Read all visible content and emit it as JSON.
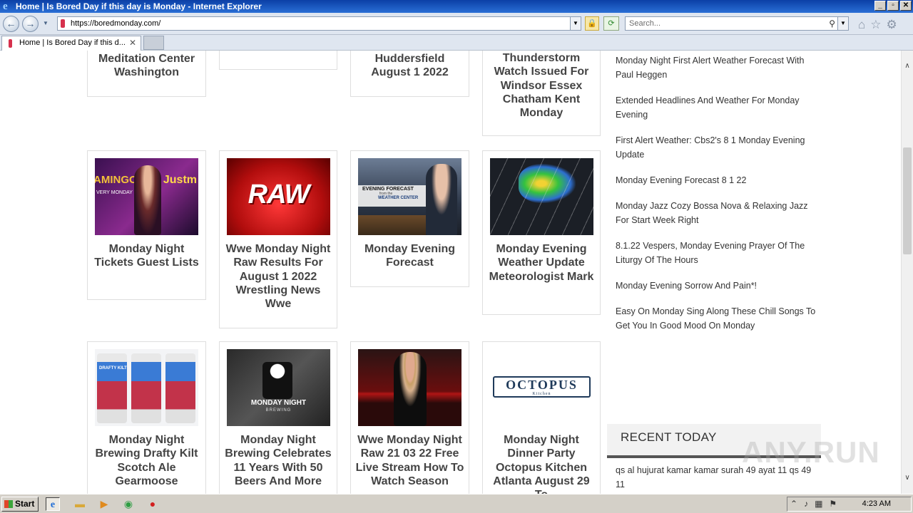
{
  "window": {
    "title": "Home | Is Bored Day if this day is Monday - Internet Explorer",
    "controls": [
      "_",
      "▫",
      "✕"
    ]
  },
  "nav": {
    "back_icon": "back-arrow-icon",
    "forward_icon": "forward-arrow-icon",
    "url": "https://boredmonday.com/",
    "search_placeholder": "Search..."
  },
  "tab": {
    "label": "Home | Is Bored Day if this d...",
    "close": "✕"
  },
  "cards": [
    {
      "title": "Meditation Center Washington",
      "thumb": "none"
    },
    {
      "title": "",
      "thumb": "none"
    },
    {
      "title": "Huddersfield August 1 2022",
      "thumb": "none"
    },
    {
      "title": "Thunderstorm Watch Issued For Windsor Essex Chatham Kent Monday",
      "thumb": "none"
    },
    {
      "title": "Monday Night Tickets Guest Lists",
      "thumb": "amingo",
      "thumb_text": [
        "AMINGO",
        "Justm",
        "VERY MONDAY"
      ]
    },
    {
      "title": "Wwe Monday Night Raw Results For August 1 2022 Wrestling News Wwe",
      "thumb": "raw",
      "thumb_text": [
        "RAW"
      ]
    },
    {
      "title": "Monday Evening Forecast",
      "thumb": "forecast",
      "thumb_text": [
        "EVENING FORECAST",
        "from the",
        "WEATHER CENTER"
      ]
    },
    {
      "title": "Monday Evening Weather Update Meteorologist Mark",
      "thumb": "radar"
    },
    {
      "title": "Monday Night Brewing Drafty Kilt Scotch Ale Gearmoose",
      "thumb": "cans",
      "thumb_text": [
        "DRAFTY KILT"
      ]
    },
    {
      "title": "Monday Night Brewing Celebrates 11 Years With 50 Beers And More",
      "thumb": "mnb",
      "thumb_text": [
        "MONDAY NIGHT",
        "BREWING"
      ]
    },
    {
      "title": "Wwe Monday Night Raw 21 03 22 Free Live Stream How To Watch Season",
      "thumb": "wrestler"
    },
    {
      "title": "Monday Night Dinner Party Octopus Kitchen Atlanta August 29 To",
      "thumb": "octopus",
      "thumb_text": [
        "OCTOPUS",
        "Kitchen"
      ]
    }
  ],
  "sidebar": {
    "links": [
      "Monday Night First Alert Weather Forecast With Paul Heggen",
      "Extended Headlines And Weather For Monday Evening",
      "First Alert Weather: Cbs2's 8 1 Monday Evening Update",
      "Monday Evening Forecast 8 1 22",
      "Monday Jazz Cozy Bossa Nova & Relaxing Jazz For Start Week Right",
      "8.1.22 Vespers, Monday Evening Prayer Of The Liturgy Of The Hours",
      "Monday Evening Sorrow And Pain*!",
      "Easy On Monday Sing Along These Chill Songs To Get You In Good Mood On Monday"
    ],
    "recent_title": "RECENT TODAY",
    "recent_links": [
      "qs al hujurat kamar kamar surah 49 ayat 11 qs 49 11"
    ]
  },
  "watermark": "ANY.RUN",
  "taskbar": {
    "start_label": "Start",
    "clock": "4:23 AM",
    "apps": [
      "ie-icon",
      "folder-icon",
      "media-player-icon",
      "chrome-icon",
      "stop-icon"
    ]
  }
}
